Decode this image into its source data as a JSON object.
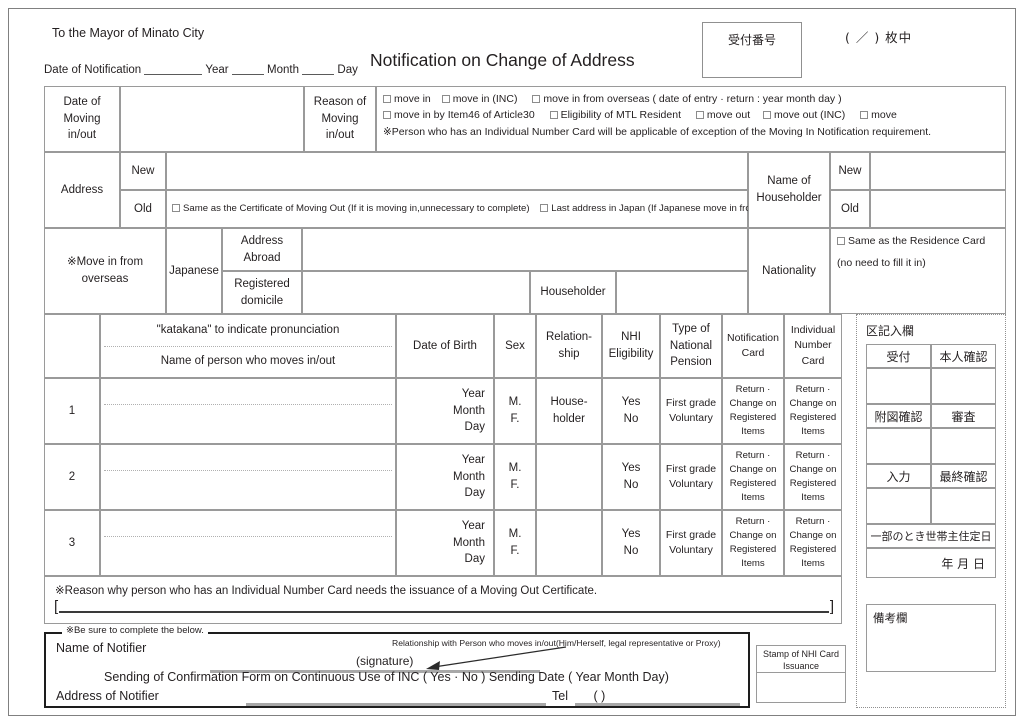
{
  "header": {
    "addressee": "To the Mayor of Minato City",
    "notification_date_label": "Date of Notification",
    "year_label": "Year",
    "month_label": "Month",
    "day_label": "Day",
    "title": "Notification on Change of Address",
    "receipt_number_label": "受付番号",
    "sheets_count": "(   ／   ) 枚中"
  },
  "moving": {
    "date_label": "Date of\nMoving\nin/out",
    "date_value": "",
    "reason_label": "Reason of\nMoving\nin/out",
    "reason_options_row1": [
      "move  in",
      "move in (INC)",
      "move in from overseas ( date  of  entry · return :        year       month       day )"
    ],
    "reason_options_row2": [
      "move in by Item46 of Article30",
      "Eligibility of MTL Resident",
      "move  out",
      "move out (INC)",
      "move"
    ],
    "reason_note": "※Person who has an Individual Number Card will be applicable of exception of the Moving In Notification requirement."
  },
  "address": {
    "label": "Address",
    "new_label": "New",
    "old_label": "Old",
    "new_value": "",
    "old_value": "",
    "old_checkboxes": [
      "Same as the Certificate of Moving Out (If it is moving in,unnecessary to complete)",
      "Last address in Japan (If Japanese move in from overseas)"
    ]
  },
  "householder": {
    "label": "Name of\nHouseholder",
    "new_label": "New",
    "old_label": "Old",
    "new_value": "",
    "old_value": ""
  },
  "overseas": {
    "label": "※Move in from\noverseas",
    "japanese_label": "Japanese",
    "address_abroad_label": "Address\nAbroad",
    "address_abroad_value": "",
    "registered_domicile_label": "Registered\ndomicile",
    "registered_domicile_value": "",
    "householder_label": "Householder",
    "householder_value": ""
  },
  "nationality": {
    "label": "Nationality",
    "checkbox": "Same as the Residence Card",
    "note": "(no need to fill it in)",
    "value": ""
  },
  "persons_table": {
    "headers": {
      "katakana": "\"katakana\" to indicate pronunciation",
      "name": "Name of person who moves in/out",
      "dob": "Date of Birth",
      "sex": "Sex",
      "relationship": "Relation-\nship",
      "nhi": "NHI\nEligibility",
      "pension": "Type of\nNational\nPension",
      "notification_card": "Notification\nCard",
      "individual_number_card": "Individual\nNumber\nCard"
    },
    "row_cell_texts": {
      "dob": "Year\nMonth\nDay",
      "sex": "M.\nF.",
      "relationship": "House-\nholder",
      "nhi": "Yes\nNo",
      "pension": "First grade\nVoluntary",
      "notification_card": "Return ·\nChange on\nRegistered\nItems",
      "individual_number_card": "Return ·\nChange on\nRegistered\nItems"
    },
    "rows": [
      {
        "no": "1",
        "katakana": "",
        "name": ""
      },
      {
        "no": "2",
        "katakana": "",
        "name": ""
      },
      {
        "no": "3",
        "katakana": "",
        "name": ""
      }
    ]
  },
  "reason_section": {
    "text": "※Reason why person who has an Individual Number Card needs the issuance of a Moving Out Certificate.",
    "bracket_open": "[",
    "bracket_close": "]",
    "value": ""
  },
  "notifier": {
    "legend": "※Be sure to complete the below.",
    "name_label": "Name of Notifier",
    "signature_label": "(signature)",
    "relationship_note": "Relationship with Person who moves in/out(Him/Herself, legal representative or Proxy)",
    "sending_label": "Sending of Confirmation Form on Continuous Use of INC (   Yes · No   )  Sending Date (       Year      Month      Day)",
    "address_label": "Address of Notifier",
    "tel_label": "Tel",
    "tel_paren": "(           )",
    "name_value": "",
    "address_value": "",
    "tel_value": "",
    "stamp_label": "Stamp of NHI Card\nIssuance"
  },
  "sidebar": {
    "title": "区記入欄",
    "cells": [
      {
        "label": "受付"
      },
      {
        "label": "本人確認"
      },
      {
        "label": "附図確認"
      },
      {
        "label": "審査"
      },
      {
        "label": "入力"
      },
      {
        "label": "最終確認"
      }
    ],
    "move_date_label": "一部のとき世帯主住定日",
    "move_date_fields": "年      月      日",
    "remarks_label": "備考欄"
  }
}
